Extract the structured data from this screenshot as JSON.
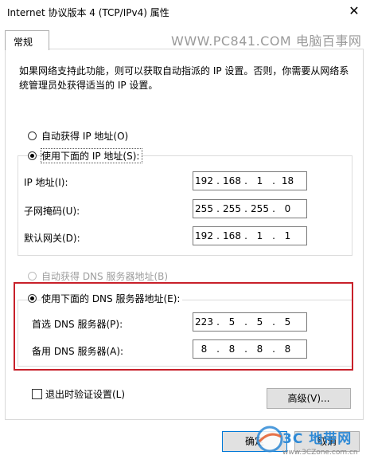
{
  "window": {
    "title": "Internet 协议版本 4 (TCP/IPv4) 属性",
    "close_glyph": "✕"
  },
  "tabs": [
    {
      "label": "常规"
    }
  ],
  "watermark": "WWW.PC841.COM 电脑百事网",
  "description": "如果网络支持此功能，则可以获取自动指派的 IP 设置。否则，你需要从网络系统管理员处获得适当的 IP 设置。",
  "ip_section": {
    "auto_label": "自动获得 IP 地址(O)",
    "manual_label": "使用下面的 IP 地址(S):",
    "selected": "manual",
    "fields": [
      {
        "label": "IP 地址(I):",
        "octets": [
          "192",
          "168",
          "1",
          "18"
        ]
      },
      {
        "label": "子网掩码(U):",
        "octets": [
          "255",
          "255",
          "255",
          "0"
        ]
      },
      {
        "label": "默认网关(D):",
        "octets": [
          "192",
          "168",
          "1",
          "1"
        ]
      }
    ]
  },
  "dns_section": {
    "auto_label": "自动获得 DNS 服务器地址(B)",
    "manual_label": "使用下面的 DNS 服务器地址(E):",
    "selected": "manual",
    "fields": [
      {
        "label": "首选 DNS 服务器(P):",
        "octets": [
          "223",
          "5",
          "5",
          "5"
        ]
      },
      {
        "label": "备用 DNS 服务器(A):",
        "octets": [
          "8",
          "8",
          "8",
          "8"
        ]
      }
    ]
  },
  "validate_checkbox": {
    "label": "退出时验证设置(L)",
    "checked": false
  },
  "buttons": {
    "advanced": "高级(V)...",
    "ok": "确定",
    "cancel": "取消"
  },
  "logo": {
    "main": "3C 地带网",
    "sub": "www.3CZone.com.cn"
  },
  "colors": {
    "highlight_border": "#c8202a",
    "focus_border": "#0078d7"
  }
}
